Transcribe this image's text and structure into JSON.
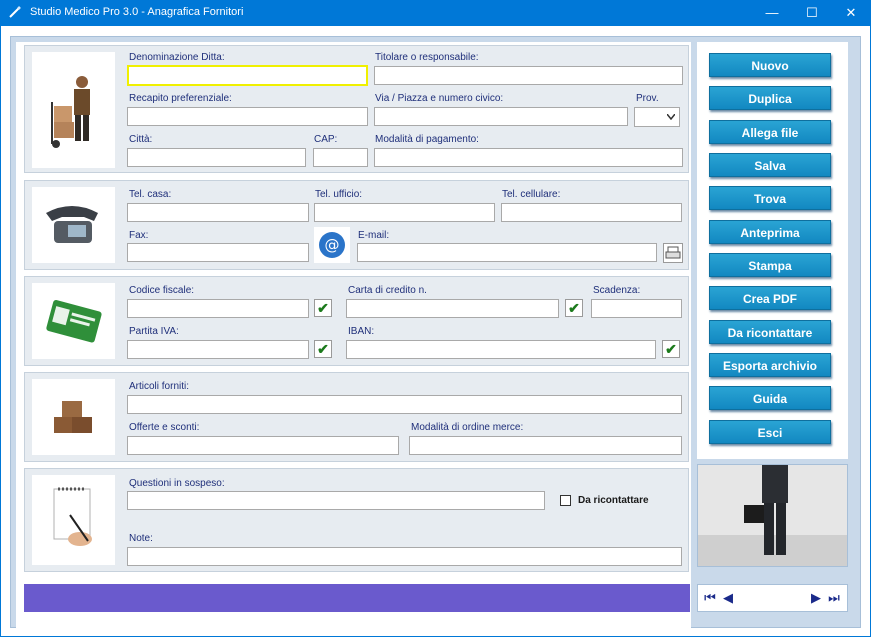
{
  "window": {
    "title": "Studio Medico Pro 3.0 - Anagrafica Fornitori",
    "minimize": "—",
    "maximize": "☐",
    "close": "✕"
  },
  "general": {
    "denominazione_label": "Denominazione Ditta:",
    "titolare_label": "Titolare o responsabile:",
    "recapito_label": "Recapito preferenziale:",
    "via_label": "Via / Piazza e numero civico:",
    "prov_label": "Prov.",
    "citta_label": "Città:",
    "cap_label": "CAP:",
    "pagamento_label": "Modalità di pagamento:"
  },
  "contacts": {
    "tel_casa_label": "Tel. casa:",
    "tel_ufficio_label": "Tel. ufficio:",
    "tel_cellulare_label": "Tel. cellulare:",
    "fax_label": "Fax:",
    "email_label": "E-mail:"
  },
  "fiscal": {
    "codice_fiscale_label": "Codice fiscale:",
    "carta_label": "Carta di credito n.",
    "scadenza_label": "Scadenza:",
    "partita_iva_label": "Partita IVA:",
    "iban_label": "IBAN:",
    "check_mark": "✔"
  },
  "articles": {
    "articoli_label": "Articoli forniti:",
    "offerte_label": "Offerte e sconti:",
    "ordine_label": "Modalità di ordine merce:"
  },
  "notes": {
    "questioni_label": "Questioni in sospeso:",
    "ricontattare_label": "Da ricontattare",
    "note_label": "Note:"
  },
  "buttons": {
    "nuovo": "Nuovo",
    "duplica": "Duplica",
    "allega": "Allega file",
    "salva": "Salva",
    "trova": "Trova",
    "anteprima": "Anteprima",
    "stampa": "Stampa",
    "crea_pdf": "Crea PDF",
    "da_ricontattare": "Da ricontattare",
    "esporta": "Esporta archivio",
    "guida": "Guida",
    "esci": "Esci"
  },
  "nav": {
    "first": "⏮",
    "prev": "◀",
    "next": "▶",
    "last": "⏭"
  }
}
